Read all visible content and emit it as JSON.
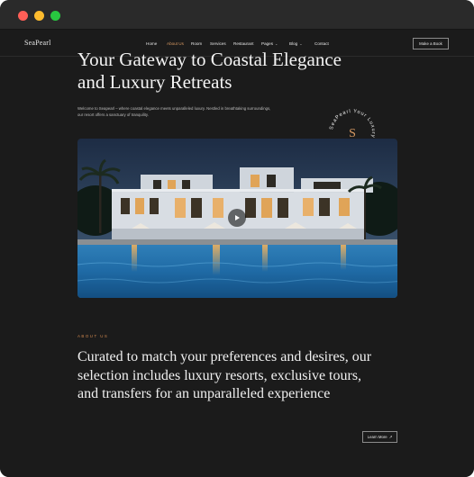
{
  "site": {
    "logo": "SeaPearl"
  },
  "nav": {
    "items": [
      {
        "label": "Home",
        "caret": ""
      },
      {
        "label": "About Us",
        "caret": ""
      },
      {
        "label": "Room",
        "caret": ""
      },
      {
        "label": "Services",
        "caret": ""
      },
      {
        "label": "Restaurant",
        "caret": ""
      },
      {
        "label": "Pages",
        "caret": "⌄"
      },
      {
        "label": "Blog",
        "caret": "⌄"
      },
      {
        "label": "Contact",
        "caret": ""
      }
    ],
    "active": "About Us",
    "cta": "Make a Book"
  },
  "hero": {
    "title": "Your Gateway to Coastal Elegance and Luxury Retreats",
    "subtitle": "Welcome to Seapearl – where coastal elegance meets unparalleled luxury. Nestled in breathtaking surroundings, our resort offers a sanctuary of tranquility."
  },
  "badge": {
    "letter": "S",
    "ring_text": "SeaPearl Your Luxury Destination ."
  },
  "about": {
    "eyebrow": "ABOUT US",
    "heading": "Curated to match your preferences and desires, our selection includes luxury resorts, exclusive tours, and transfers for an unparalleled experience",
    "button": "Learn More",
    "button_arrow": "↗"
  },
  "colors": {
    "accent": "#d89a63",
    "background": "#1b1b1b"
  },
  "icons": {
    "play": "play-icon"
  }
}
